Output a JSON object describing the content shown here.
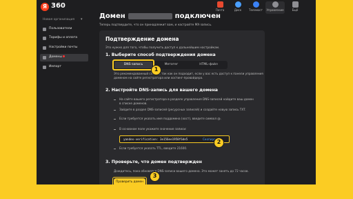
{
  "header": {
    "logo_letter": "Я",
    "brand": "360",
    "apps": [
      {
        "label": "Почта",
        "color": "#e8492f"
      },
      {
        "label": "Диск",
        "color": "#4a9fff"
      },
      {
        "label": "Телемост",
        "color": "#3b82f6"
      },
      {
        "label": "Управление",
        "color": "#8e8e93"
      },
      {
        "label": "Ещё",
        "color": "#8e8e93"
      }
    ]
  },
  "sidebar": {
    "org_name": "Новая организация",
    "items": [
      {
        "label": "Пользователи"
      },
      {
        "label": "Тарифы и оплата"
      },
      {
        "label": "Настройки почты"
      },
      {
        "label": "Домены"
      },
      {
        "label": "Импорт"
      }
    ]
  },
  "page": {
    "title_prefix": "Домен",
    "title_suffix": "подключен",
    "subtitle": "Теперь подтвердите, что он принадлежит вам, и настройте MX-запись."
  },
  "card": {
    "title": "Подтверждение домена",
    "description": "Это нужно для того, чтобы получить доступ к дальнейшим настройкам.",
    "step1": {
      "heading": "1.  Выберите способ подтверждения домена",
      "tabs": [
        "DNS-запись",
        "Метатег",
        "HTML-файл"
      ],
      "line1": "Это рекомендованный способ, так как он подходит, если у вас есть доступ к панели управления",
      "line2": "доменом на сайте регистратора или хостинг-провайдера."
    },
    "step2": {
      "heading": "2.  Настройте DNS-запись для вашего домена",
      "items": [
        "На сайте вашего регистратора в разделе управления DNS-записей найдите ваш домен",
        "в списке доменов.",
        "Зайдите в раздел DNS-записей (ресурсных записей) и создайте новую запись TXT.",
        "Если требуется указать имя поддомена (хост), введите символ @.",
        "В основном поле укажите значение записи:"
      ],
      "record_value": "yandex-verification: 3e156ee1958f6de5",
      "copy_label": "Скопировать",
      "ttl_note": "Если требуется указать TTL, введите 21600."
    },
    "step3": {
      "heading": "3.  Проверьте, что домен подтвержден",
      "description": "Дождитесь, пока обновятся DNS-записи вашего домена. Это может занять до 72 часов.",
      "button_label": "Проверить домен"
    }
  },
  "callouts": [
    "1",
    "2",
    "3"
  ],
  "colors": {
    "accent": "#fbcc23",
    "background": "#1e1e20",
    "card": "#2a2a2d",
    "link": "#4a9fff"
  }
}
